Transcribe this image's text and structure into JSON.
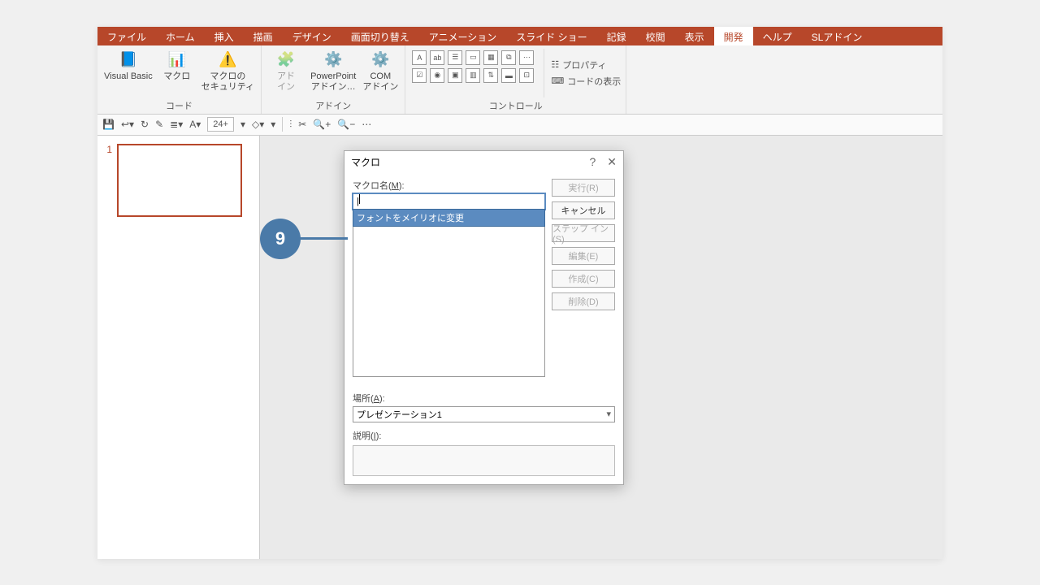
{
  "tabs": [
    "ファイル",
    "ホーム",
    "挿入",
    "描画",
    "デザイン",
    "画面切り替え",
    "アニメーション",
    "スライド ショー",
    "記録",
    "校閲",
    "表示",
    "開発",
    "ヘルプ",
    "SLアドイン"
  ],
  "active_tab": "開発",
  "ribbon": {
    "group_code": "コード",
    "group_addin": "アドイン",
    "group_control": "コントロール",
    "vb": "Visual Basic",
    "macro": "マクロ",
    "security": "マクロの\nセキュリティ",
    "addin": "アド\nイン",
    "ppaddin": "PowerPoint\nアドイン…",
    "comaddin": "COM\nアドイン",
    "property": "プロパティ",
    "viewcode": "コードの表示"
  },
  "qat_font": "24+",
  "thumb_num": "1",
  "badge": "9",
  "dialog": {
    "title": "マクロ",
    "name_label_pre": "マクロ名(",
    "name_label_u": "M",
    "name_label_post": "):",
    "macro_item": "フォントをメイリオに変更",
    "location_label_pre": "場所(",
    "location_label_u": "A",
    "location_label_post": "):",
    "location_value": "プレゼンテーション1",
    "desc_label_pre": "説明(",
    "desc_label_u": "I",
    "desc_label_post": "):",
    "buttons": {
      "run": "実行(R)",
      "cancel": "キャンセル",
      "stepin": "ステップ イン(S)",
      "edit": "編集(E)",
      "create": "作成(C)",
      "delete": "削除(D)"
    }
  }
}
